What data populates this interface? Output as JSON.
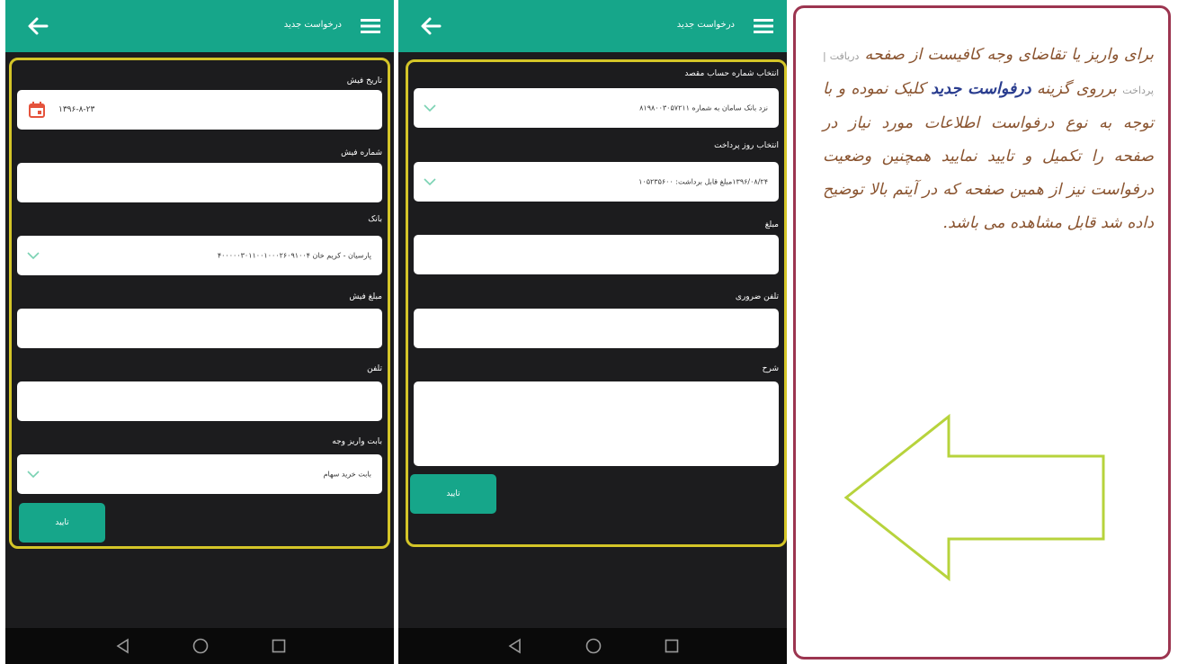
{
  "screen1": {
    "title": "درخواست جدید",
    "fields": {
      "date_label": "تاریخ فیش",
      "date_value": "۱۳۹۶-۸-۲۳",
      "receipt_no_label": "شماره فیش",
      "bank_label": "بانک",
      "bank_value": "پارسیان - کریم خان ۴۰۰۰۰۰۳۰۱۱۰۰۱۰۰۰۲۶۰۹۱۰۰۴",
      "receipt_amount_label": "مبلغ فیش",
      "phone_label": "تلفن",
      "deposit_purpose_label": "بابت واریز وجه",
      "deposit_purpose_value": "بابت خرید سهام"
    },
    "submit_label": "تایید"
  },
  "screen2": {
    "title": "درخواست جدید",
    "fields": {
      "dest_account_label": "انتخاب شماره حساب مقصد",
      "dest_account_value": "نزد بانک سامان به شماره ۸۱۹۸۰۰۳۰۵۷۲۱۱",
      "pay_day_label": "انتخاب روز پرداخت",
      "pay_day_value": "۱۳۹۶/۰۸/۲۴مبلغ قابل برداشت: ۱۰۵۲۳۵۶۰۰",
      "amount_label": "مبلغ",
      "emergency_phone_label": "تلفن ضروری",
      "description_label": "شرح"
    },
    "submit_label": "تایید"
  },
  "icons": {
    "back": "arrow-left-icon",
    "menu": "hamburger-menu-icon",
    "calendar": "calendar-icon",
    "dropdown": "chevron-down-icon",
    "nav_back": "triangle-back-icon",
    "nav_home": "circle-home-icon",
    "nav_recents": "square-recents-icon"
  },
  "instructions": {
    "p1": "برای واریز یا تقاضای وجه کافیست از صفحه",
    "hint": "دریافت | پرداخت",
    "p2": "برروی گزینه",
    "link": "درفواست جدید",
    "p3": "کلیک نموده و با توجه به نوع درفواست اطلاعات مورد نیاز در صفحه را تکمیل و تایید نمایید همچنین وضعیت درفواست نیز از همین صفحه که در آیتم بالا توضیح داده شد قابل مشاهده می باشد."
  },
  "colors": {
    "app_bar": "#16a68a",
    "form_border": "#d4c528",
    "panel_border": "#9c3550",
    "text_brown": "#8a5430",
    "link_blue": "#2a3d8f",
    "arrow_outline": "#b7d33c"
  }
}
